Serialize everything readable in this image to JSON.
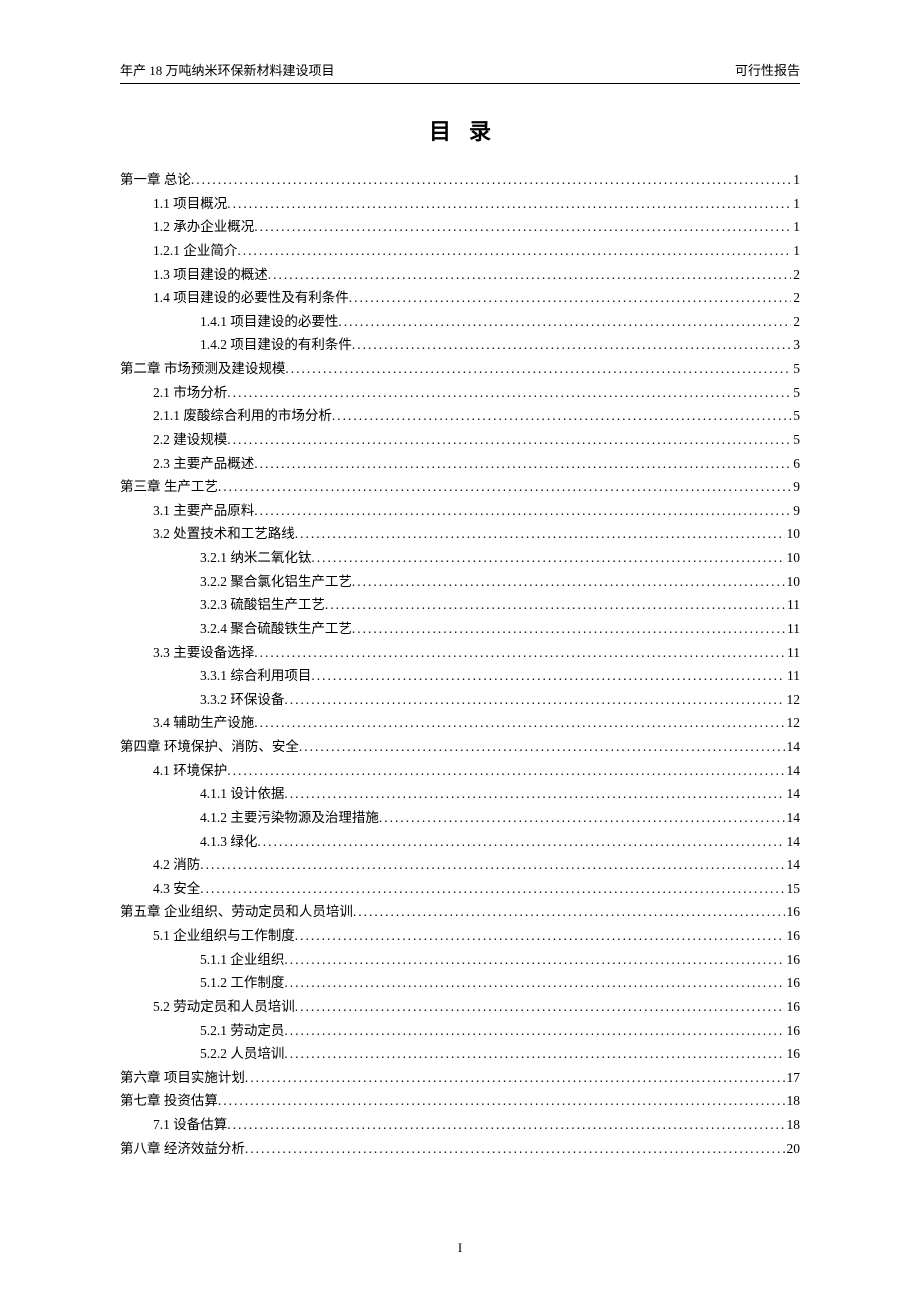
{
  "header": {
    "left": "年产 18 万吨纳米环保新材料建设项目",
    "right": "可行性报告"
  },
  "title": "目录",
  "footer": "I",
  "toc": [
    {
      "level": 0,
      "label": "第一章   总论",
      "page": "1"
    },
    {
      "level": 1,
      "label": "1.1 项目概况",
      "page": "1"
    },
    {
      "level": 1,
      "label": "1.2 承办企业概况",
      "page": "1"
    },
    {
      "level": 1,
      "label": "1.2.1 企业简介",
      "page": "1"
    },
    {
      "level": 1,
      "label": "1.3 项目建设的概述",
      "page": "2"
    },
    {
      "level": 1,
      "label": "1.4 项目建设的必要性及有利条件",
      "page": "2"
    },
    {
      "level": 2,
      "label": "1.4.1 项目建设的必要性",
      "page": "2"
    },
    {
      "level": 2,
      "label": "1.4.2 项目建设的有利条件",
      "page": "3"
    },
    {
      "level": 0,
      "label": "第二章 市场预测及建设规模",
      "page": "5"
    },
    {
      "level": 1,
      "label": "2.1 市场分析",
      "page": "5"
    },
    {
      "level": 1,
      "label": "2.1.1 废酸综合利用的市场分析",
      "page": "5"
    },
    {
      "level": 1,
      "label": "2.2  建设规模",
      "page": "5"
    },
    {
      "level": 1,
      "label": "2.3 主要产品概述",
      "page": "6"
    },
    {
      "level": 0,
      "label": "第三章 生产工艺",
      "page": "9"
    },
    {
      "level": 1,
      "label": "3.1 主要产品原料",
      "page": "9"
    },
    {
      "level": 1,
      "label": "3.2 处置技术和工艺路线",
      "page": "10"
    },
    {
      "level": 2,
      "label": "3.2.1  纳米二氧化钛",
      "page": "10"
    },
    {
      "level": 2,
      "label": "3.2.2 聚合氯化铝生产工艺",
      "page": "10"
    },
    {
      "level": 2,
      "label": "3.2.3 硫酸铝生产工艺",
      "page": "11"
    },
    {
      "level": 2,
      "label": "3.2.4 聚合硫酸铁生产工艺",
      "page": "11"
    },
    {
      "level": 1,
      "label": "3.3 主要设备选择",
      "page": "11"
    },
    {
      "level": 2,
      "label": "3.3.1 综合利用项目",
      "page": "11"
    },
    {
      "level": 2,
      "label": "3.3.2 环保设备",
      "page": "12"
    },
    {
      "level": 1,
      "label": "3.4 辅助生产设施",
      "page": "12"
    },
    {
      "level": 0,
      "label": "第四章 环境保护、消防、安全",
      "page": "14"
    },
    {
      "level": 1,
      "label": "4.1 环境保护",
      "page": "14"
    },
    {
      "level": 2,
      "label": "4.1.1 设计依据",
      "page": "14"
    },
    {
      "level": 2,
      "label": "4.1.2 主要污染物源及治理措施",
      "page": "14"
    },
    {
      "level": 2,
      "label": "4.1.3  绿化",
      "page": "14"
    },
    {
      "level": 1,
      "label": "4.2 消防",
      "page": "14"
    },
    {
      "level": 1,
      "label": "4.3 安全",
      "page": "15"
    },
    {
      "level": 0,
      "label": "第五章 企业组织、劳动定员和人员培训",
      "page": "16"
    },
    {
      "level": 1,
      "label": "5.1 企业组织与工作制度",
      "page": "16"
    },
    {
      "level": 2,
      "label": "5.1.1 企业组织",
      "page": "16"
    },
    {
      "level": 2,
      "label": "5.1.2 工作制度",
      "page": "16"
    },
    {
      "level": 1,
      "label": "5.2 劳动定员和人员培训",
      "page": "16"
    },
    {
      "level": 2,
      "label": "5.2.1 劳动定员",
      "page": "16"
    },
    {
      "level": 2,
      "label": "5.2.2 人员培训",
      "page": "16"
    },
    {
      "level": 0,
      "label": "第六章 项目实施计划",
      "page": "17"
    },
    {
      "level": 0,
      "label": "第七章 投资估算",
      "page": "18"
    },
    {
      "level": 1,
      "label": "7.1 设备估算",
      "page": "18"
    },
    {
      "level": 0,
      "label": "第八章 经济效益分析",
      "page": "20"
    }
  ]
}
